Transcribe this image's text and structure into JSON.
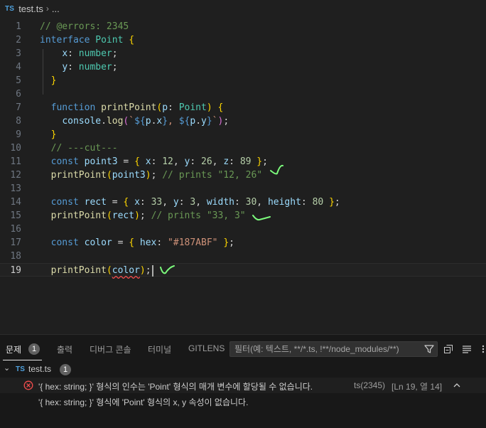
{
  "breadcrumb": {
    "lang_badge": "TS",
    "file": "test.ts",
    "more": "..."
  },
  "editor": {
    "lines": [
      {
        "n": "1",
        "tokens": [
          {
            "t": "// @errors: 2345",
            "c": "cm"
          }
        ]
      },
      {
        "n": "2",
        "tokens": [
          {
            "t": "interface",
            "c": "kw"
          },
          {
            "t": " ",
            "c": "pu"
          },
          {
            "t": "Point",
            "c": "ty"
          },
          {
            "t": " ",
            "c": "pu"
          },
          {
            "t": "{",
            "c": "b1"
          }
        ]
      },
      {
        "n": "3",
        "tokens": [
          {
            "t": "    ",
            "c": "pu"
          },
          {
            "t": "x",
            "c": "pr"
          },
          {
            "t": ": ",
            "c": "pu"
          },
          {
            "t": "number",
            "c": "ty"
          },
          {
            "t": ";",
            "c": "pu"
          }
        ]
      },
      {
        "n": "4",
        "tokens": [
          {
            "t": "    ",
            "c": "pu"
          },
          {
            "t": "y",
            "c": "pr"
          },
          {
            "t": ": ",
            "c": "pu"
          },
          {
            "t": "number",
            "c": "ty"
          },
          {
            "t": ";",
            "c": "pu"
          }
        ]
      },
      {
        "n": "5",
        "tokens": [
          {
            "t": "  ",
            "c": "pu"
          },
          {
            "t": "}",
            "c": "b1"
          }
        ]
      },
      {
        "n": "6",
        "tokens": []
      },
      {
        "n": "7",
        "tokens": [
          {
            "t": "  ",
            "c": "pu"
          },
          {
            "t": "function",
            "c": "kw"
          },
          {
            "t": " ",
            "c": "pu"
          },
          {
            "t": "printPoint",
            "c": "fn"
          },
          {
            "t": "(",
            "c": "b1"
          },
          {
            "t": "p",
            "c": "pr"
          },
          {
            "t": ": ",
            "c": "pu"
          },
          {
            "t": "Point",
            "c": "ty"
          },
          {
            "t": ")",
            "c": "b1"
          },
          {
            "t": " ",
            "c": "pu"
          },
          {
            "t": "{",
            "c": "b1"
          }
        ]
      },
      {
        "n": "8",
        "tokens": [
          {
            "t": "    ",
            "c": "pu"
          },
          {
            "t": "console",
            "c": "pr"
          },
          {
            "t": ".",
            "c": "pu"
          },
          {
            "t": "log",
            "c": "fn"
          },
          {
            "t": "(",
            "c": "b2"
          },
          {
            "t": "`",
            "c": "st"
          },
          {
            "t": "${",
            "c": "kw"
          },
          {
            "t": "p",
            "c": "pr"
          },
          {
            "t": ".",
            "c": "pu"
          },
          {
            "t": "x",
            "c": "pr"
          },
          {
            "t": "}",
            "c": "kw"
          },
          {
            "t": ", ",
            "c": "st"
          },
          {
            "t": "${",
            "c": "kw"
          },
          {
            "t": "p",
            "c": "pr"
          },
          {
            "t": ".",
            "c": "pu"
          },
          {
            "t": "y",
            "c": "pr"
          },
          {
            "t": "}",
            "c": "kw"
          },
          {
            "t": "`",
            "c": "st"
          },
          {
            "t": ")",
            "c": "b2"
          },
          {
            "t": ";",
            "c": "pu"
          }
        ]
      },
      {
        "n": "9",
        "tokens": [
          {
            "t": "  ",
            "c": "pu"
          },
          {
            "t": "}",
            "c": "b1"
          }
        ]
      },
      {
        "n": "10",
        "tokens": [
          {
            "t": "  ",
            "c": "pu"
          },
          {
            "t": "// ---cut---",
            "c": "cm"
          }
        ]
      },
      {
        "n": "11",
        "tokens": [
          {
            "t": "  ",
            "c": "pu"
          },
          {
            "t": "const",
            "c": "kw"
          },
          {
            "t": " ",
            "c": "pu"
          },
          {
            "t": "point3",
            "c": "pr"
          },
          {
            "t": " = ",
            "c": "pu"
          },
          {
            "t": "{",
            "c": "b1"
          },
          {
            "t": " ",
            "c": "pu"
          },
          {
            "t": "x",
            "c": "pr"
          },
          {
            "t": ": ",
            "c": "pu"
          },
          {
            "t": "12",
            "c": "nu"
          },
          {
            "t": ", ",
            "c": "pu"
          },
          {
            "t": "y",
            "c": "pr"
          },
          {
            "t": ": ",
            "c": "pu"
          },
          {
            "t": "26",
            "c": "nu"
          },
          {
            "t": ", ",
            "c": "pu"
          },
          {
            "t": "z",
            "c": "pr"
          },
          {
            "t": ": ",
            "c": "pu"
          },
          {
            "t": "89",
            "c": "nu"
          },
          {
            "t": " ",
            "c": "pu"
          },
          {
            "t": "}",
            "c": "b1"
          },
          {
            "t": ";",
            "c": "pu"
          }
        ]
      },
      {
        "n": "12",
        "tokens": [
          {
            "t": "  ",
            "c": "pu"
          },
          {
            "t": "printPoint",
            "c": "fn"
          },
          {
            "t": "(",
            "c": "b1"
          },
          {
            "t": "point3",
            "c": "pr"
          },
          {
            "t": ")",
            "c": "b1"
          },
          {
            "t": "; ",
            "c": "pu"
          },
          {
            "t": "// prints \"12, 26\"",
            "c": "cm"
          }
        ]
      },
      {
        "n": "13",
        "tokens": []
      },
      {
        "n": "14",
        "tokens": [
          {
            "t": "  ",
            "c": "pu"
          },
          {
            "t": "const",
            "c": "kw"
          },
          {
            "t": " ",
            "c": "pu"
          },
          {
            "t": "rect",
            "c": "pr"
          },
          {
            "t": " = ",
            "c": "pu"
          },
          {
            "t": "{",
            "c": "b1"
          },
          {
            "t": " ",
            "c": "pu"
          },
          {
            "t": "x",
            "c": "pr"
          },
          {
            "t": ": ",
            "c": "pu"
          },
          {
            "t": "33",
            "c": "nu"
          },
          {
            "t": ", ",
            "c": "pu"
          },
          {
            "t": "y",
            "c": "pr"
          },
          {
            "t": ": ",
            "c": "pu"
          },
          {
            "t": "3",
            "c": "nu"
          },
          {
            "t": ", ",
            "c": "pu"
          },
          {
            "t": "width",
            "c": "pr"
          },
          {
            "t": ": ",
            "c": "pu"
          },
          {
            "t": "30",
            "c": "nu"
          },
          {
            "t": ", ",
            "c": "pu"
          },
          {
            "t": "height",
            "c": "pr"
          },
          {
            "t": ": ",
            "c": "pu"
          },
          {
            "t": "80",
            "c": "nu"
          },
          {
            "t": " ",
            "c": "pu"
          },
          {
            "t": "}",
            "c": "b1"
          },
          {
            "t": ";",
            "c": "pu"
          }
        ]
      },
      {
        "n": "15",
        "tokens": [
          {
            "t": "  ",
            "c": "pu"
          },
          {
            "t": "printPoint",
            "c": "fn"
          },
          {
            "t": "(",
            "c": "b1"
          },
          {
            "t": "rect",
            "c": "pr"
          },
          {
            "t": ")",
            "c": "b1"
          },
          {
            "t": "; ",
            "c": "pu"
          },
          {
            "t": "// prints \"33, 3\"",
            "c": "cm"
          }
        ]
      },
      {
        "n": "16",
        "tokens": []
      },
      {
        "n": "17",
        "tokens": [
          {
            "t": "  ",
            "c": "pu"
          },
          {
            "t": "const",
            "c": "kw"
          },
          {
            "t": " ",
            "c": "pu"
          },
          {
            "t": "color",
            "c": "pr"
          },
          {
            "t": " = ",
            "c": "pu"
          },
          {
            "t": "{",
            "c": "b1"
          },
          {
            "t": " ",
            "c": "pu"
          },
          {
            "t": "hex",
            "c": "pr"
          },
          {
            "t": ": ",
            "c": "pu"
          },
          {
            "t": "\"#187ABF\"",
            "c": "st"
          },
          {
            "t": " ",
            "c": "pu"
          },
          {
            "t": "}",
            "c": "b1"
          },
          {
            "t": ";",
            "c": "pu"
          }
        ]
      },
      {
        "n": "18",
        "tokens": []
      },
      {
        "n": "19",
        "current": true,
        "tokens": [
          {
            "t": "  ",
            "c": "pu"
          },
          {
            "t": "printPoint",
            "c": "fn"
          },
          {
            "t": "(",
            "c": "b1"
          },
          {
            "t": "color",
            "c": "pr sq"
          },
          {
            "t": ")",
            "c": "b1"
          },
          {
            "t": ";",
            "c": "pu"
          }
        ]
      }
    ]
  },
  "panel": {
    "tabs": [
      {
        "label": "문제",
        "badge": "1",
        "active": true
      },
      {
        "label": "출력"
      },
      {
        "label": "디버그 콘솔"
      },
      {
        "label": "터미널"
      },
      {
        "label": "GITLENS"
      }
    ],
    "filter_placeholder": "필터(예: 텍스트, **/*.ts, !**/node_modules/**)",
    "file": {
      "badge": "TS",
      "name": "test.ts",
      "count": "1"
    },
    "problem": {
      "message": "'{ hex: string; }' 형식의 인수는 'Point' 형식의 매개 변수에 할당될 수 없습니다.",
      "source": "ts(2345)",
      "location": "[Ln 19, 열 14]",
      "detail": "'{ hex: string; }' 형식에 'Point' 형식의 x, y 속성이 없습니다."
    }
  },
  "colors": {
    "editor_bg": "#1f1f1f",
    "panel_bg": "#181818",
    "error": "#f14c4c",
    "annotation": "#7cfc7c"
  }
}
